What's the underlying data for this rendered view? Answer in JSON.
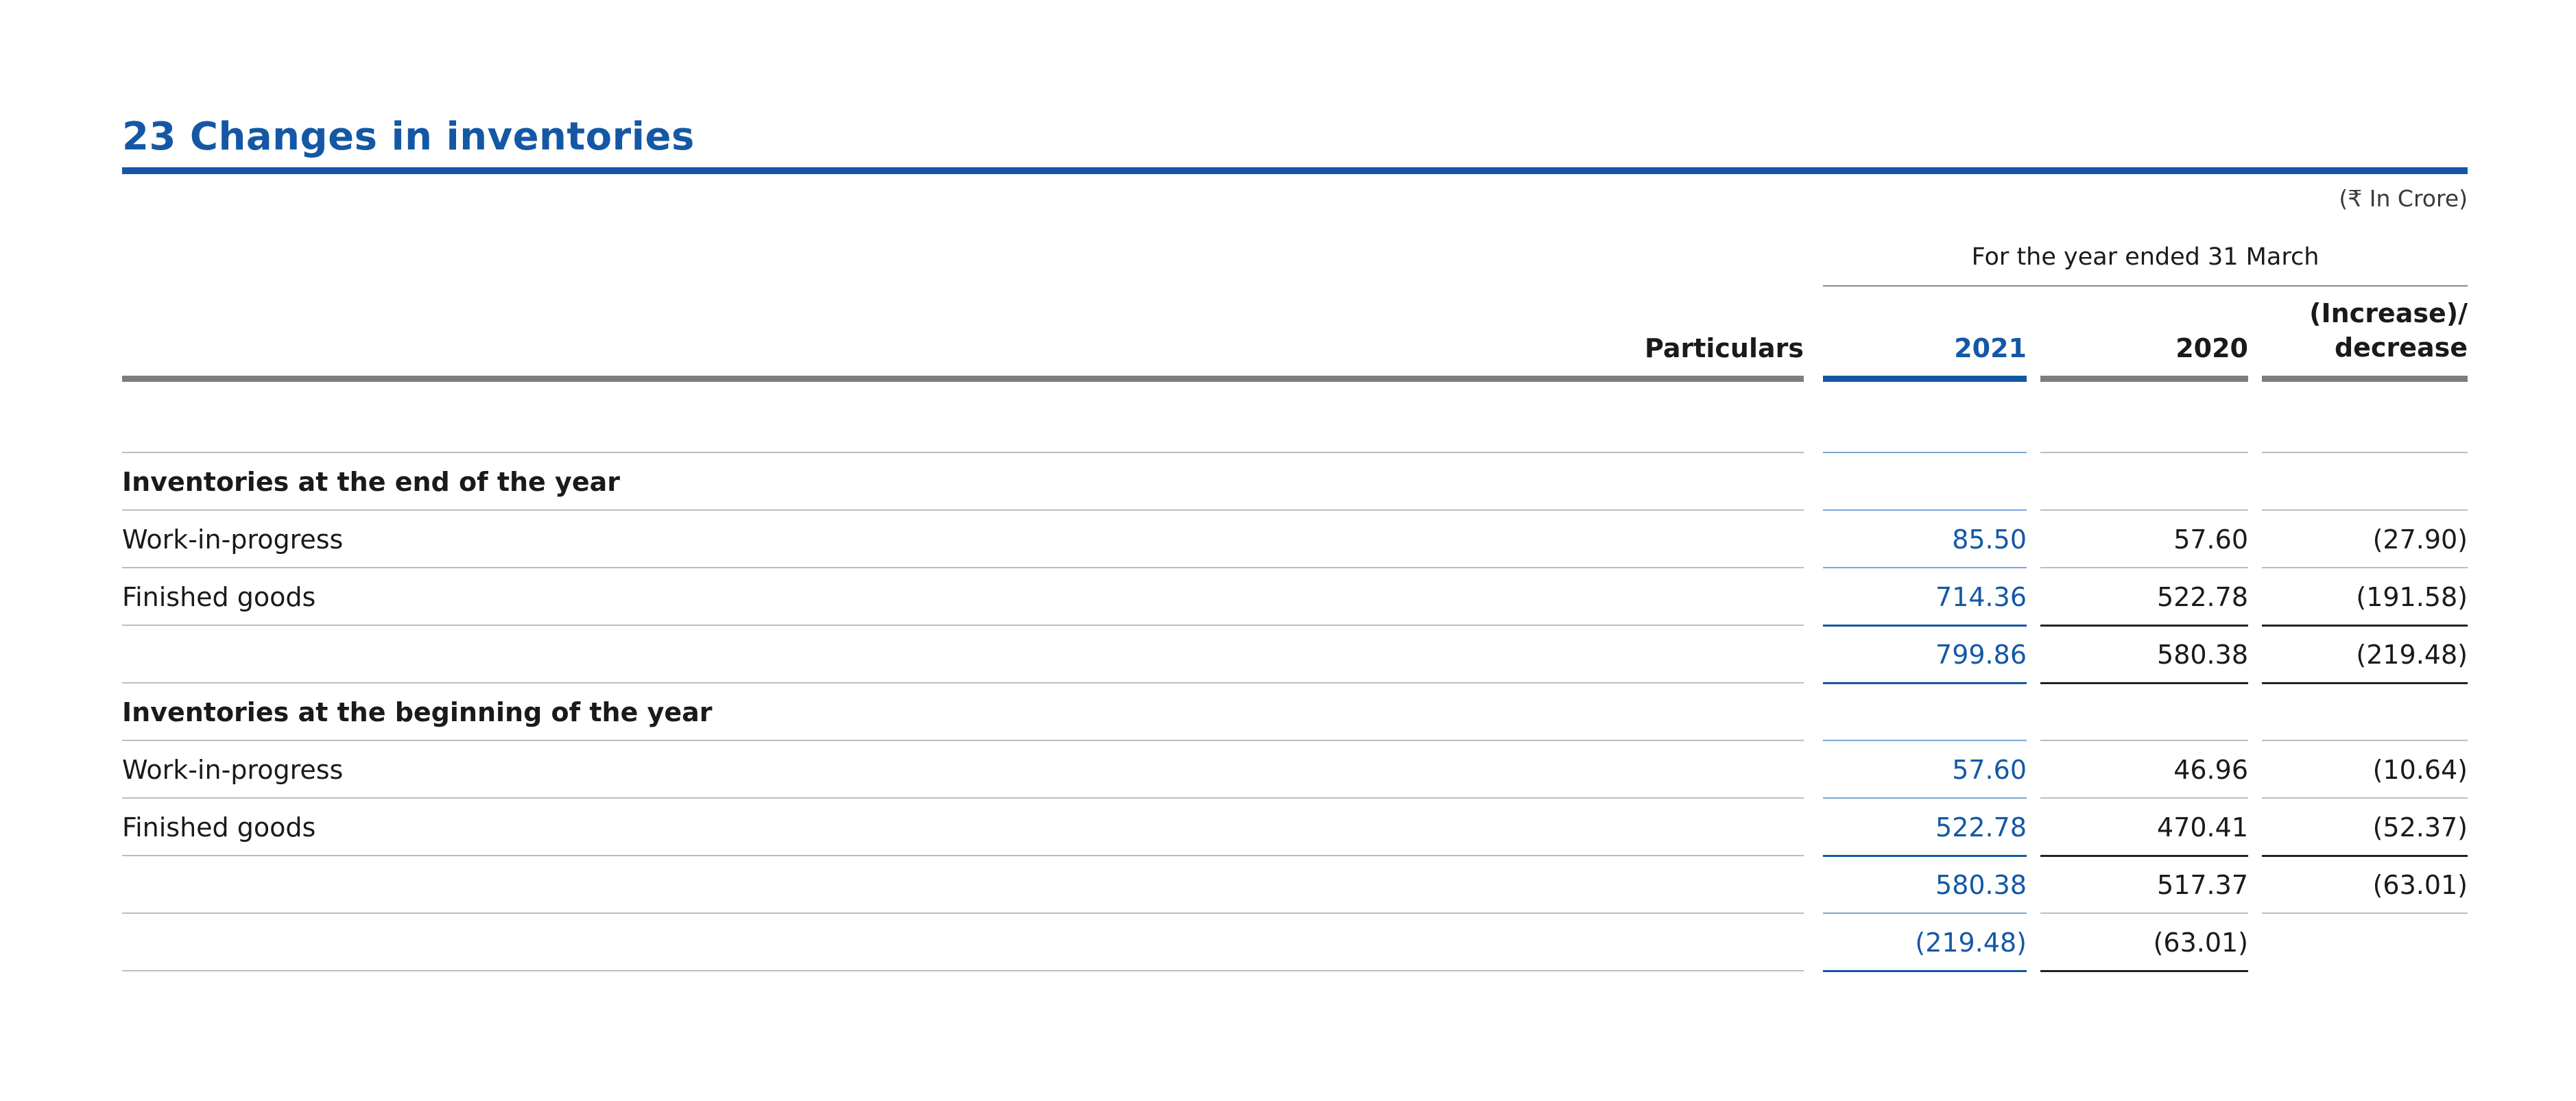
{
  "title": "23 Changes in inventories",
  "unit": "(₹ In Crore)",
  "period_header": "For the year ended 31 March",
  "columns": {
    "particulars": "Particulars",
    "year1": "2021",
    "year2": "2020",
    "change": "(Increase)/ decrease"
  },
  "colors": {
    "accent": "#1458a5",
    "text": "#1a1a1a"
  },
  "rows": [
    {
      "label": "",
      "y1": "",
      "y2": "",
      "chg": "",
      "bold": false
    },
    {
      "label": "Inventories at the end of the year",
      "y1": "",
      "y2": "",
      "chg": "",
      "bold": true
    },
    {
      "label": "Work-in-progress",
      "y1": "85.50",
      "y2": "57.60",
      "chg": "(27.90)",
      "bold": false
    },
    {
      "label": "Finished goods",
      "y1": "714.36",
      "y2": "522.78",
      "chg": "(191.58)",
      "bold": false
    },
    {
      "label": "",
      "y1": "799.86",
      "y2": "580.38",
      "chg": "(219.48)",
      "bold": false
    },
    {
      "label": "Inventories at the beginning of the year",
      "y1": "",
      "y2": "",
      "chg": "",
      "bold": true
    },
    {
      "label": "Work-in-progress",
      "y1": "57.60",
      "y2": "46.96",
      "chg": "(10.64)",
      "bold": false
    },
    {
      "label": "Finished goods",
      "y1": "522.78",
      "y2": "470.41",
      "chg": "(52.37)",
      "bold": false
    },
    {
      "label": "",
      "y1": "580.38",
      "y2": "517.37",
      "chg": "(63.01)",
      "bold": false
    },
    {
      "label": "",
      "y1": "(219.48)",
      "y2": "(63.01)",
      "chg": "",
      "bold": false
    }
  ]
}
